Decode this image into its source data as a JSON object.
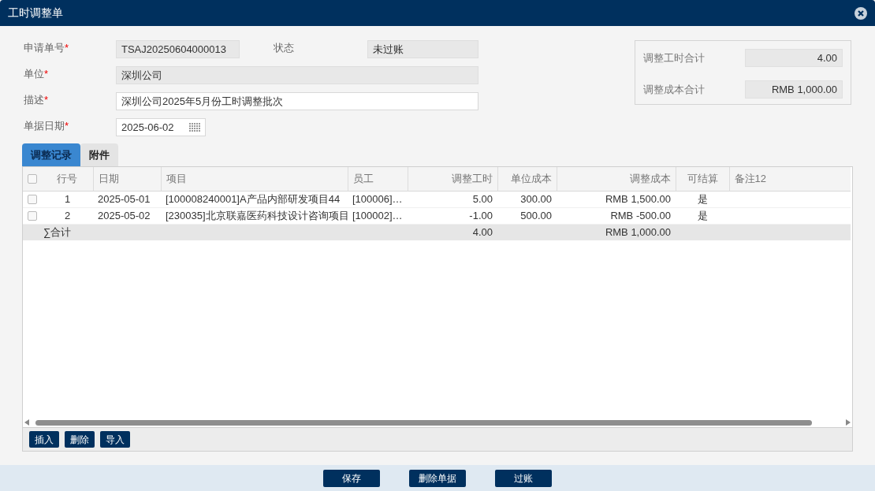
{
  "window": {
    "title": "工时调整单"
  },
  "form": {
    "required_mark": "*",
    "fields": [
      {
        "label": "申请单号",
        "required": true,
        "value": "TSAJ20250604000013",
        "readonly": true
      },
      {
        "label": "状态",
        "required": false,
        "value": "未过账",
        "readonly": true
      },
      {
        "label": "单位",
        "required": true,
        "value": "深圳公司",
        "readonly": true
      },
      {
        "label": "描述",
        "required": true,
        "value": "深圳公司2025年5月份工时调整批次",
        "readonly": false
      },
      {
        "label": "单据日期",
        "required": true,
        "value": "2025-06-02",
        "readonly": false
      }
    ]
  },
  "summary": [
    {
      "label": "调整工时合计",
      "value": "4.00"
    },
    {
      "label": "调整成本合计",
      "value": "RMB 1,000.00"
    }
  ],
  "tabs": [
    {
      "label": "调整记录",
      "selected": true
    },
    {
      "label": "附件",
      "selected": false
    }
  ],
  "table": {
    "header_checked": false,
    "columns": [
      "行号",
      "日期",
      "项目",
      "员工",
      "调整工时",
      "单位成本",
      "调整成本",
      "可结算",
      "备注12"
    ],
    "rows": [
      {
        "checked": false,
        "cells": [
          "1",
          "2025-05-01",
          "[100008240001]A产品内部研发项目44",
          "[100006]…",
          "5.00",
          "300.00",
          "RMB 1,500.00",
          "是",
          ""
        ]
      },
      {
        "checked": false,
        "cells": [
          "2",
          "2025-05-02",
          "[230035]北京联嘉医药科技设计咨询项目",
          "[100002]…",
          "-1.00",
          "500.00",
          "RMB -500.00",
          "是",
          ""
        ]
      }
    ],
    "total": {
      "label": "∑合计",
      "cells": [
        "",
        "",
        "",
        "",
        "4.00",
        "",
        "RMB 1,000.00",
        "",
        ""
      ]
    }
  },
  "toolbar": [
    "插入",
    "删除",
    "导入"
  ],
  "footer_buttons": [
    "保存",
    "删除单据",
    "过账"
  ]
}
